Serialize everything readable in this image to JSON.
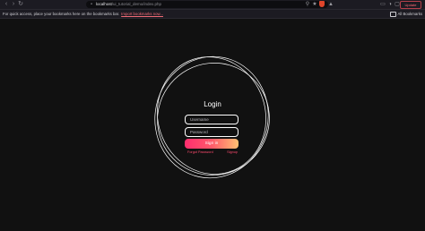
{
  "browser": {
    "url_host": "localhost",
    "url_path": "/ui_tutorial_demo/index.php",
    "update_label": "Update",
    "colors": {
      "toolbar": "#1c1b22",
      "shield": "#e0452b",
      "update_border": "#b4404a"
    }
  },
  "bookmarks_bar": {
    "message": "For quick access, place your bookmarks here on the bookmarks bar.",
    "import_link": "Import bookmarks now...",
    "all_bookmarks": "All Bookmarks"
  },
  "login": {
    "title": "Login",
    "username_placeholder": "Username",
    "password_placeholder": "Password",
    "signin_label": "Sign in",
    "forgot_label": "Forgot Password",
    "signup_label": "Signup",
    "colors": {
      "background": "#111111",
      "gradient_start": "#ff2d6f",
      "gradient_end": "#ffc073",
      "link": "#ff4a6e",
      "ring": "#ffffff"
    }
  }
}
